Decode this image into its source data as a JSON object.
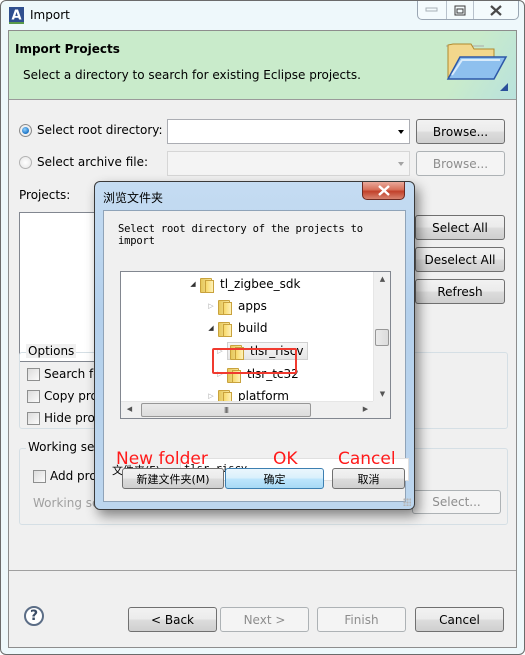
{
  "window": {
    "title": "Import",
    "app_icon": "eclipse-a-icon",
    "controls": [
      "minimize",
      "maximize",
      "close"
    ]
  },
  "banner": {
    "title": "Import Projects",
    "description": "Select a directory to search for existing Eclipse projects.",
    "icon": "open-folder-icon",
    "bg_color": "#c9ebcb"
  },
  "source": {
    "root_directory": {
      "label": "Select root directory:",
      "selected": true,
      "value": "",
      "browse_label": "Browse..."
    },
    "archive_file": {
      "label": "Select archive file:",
      "selected": false,
      "enabled": false,
      "value": "",
      "browse_label": "Browse..."
    }
  },
  "projects": {
    "label": "Projects:",
    "items": [],
    "select_all_label": "Select All",
    "deselect_all_label": "Deselect All",
    "refresh_label": "Refresh"
  },
  "options": {
    "title": "Options",
    "checkboxes": [
      {
        "label": "Search fo",
        "checked": false
      },
      {
        "label": "Copy pro",
        "checked": false
      },
      {
        "label": "Hide pro",
        "checked": false
      }
    ]
  },
  "working_sets": {
    "title": "Working se",
    "add_label": "Add pro",
    "add_checked": false,
    "working_sets_label": "Working se",
    "select_label": "Select..."
  },
  "footer": {
    "help_icon": "help-icon",
    "back_label": "< Back",
    "next_label": "Next >",
    "finish_label": "Finish",
    "cancel_label": "Cancel"
  },
  "browse_dialog": {
    "title": "浏览文件夹",
    "description": "Select root directory of the projects to import",
    "tree": [
      {
        "label": "tl_zigbee_sdk",
        "expanded": true,
        "level": 0
      },
      {
        "label": "apps",
        "expanded": false,
        "level": 1
      },
      {
        "label": "build",
        "expanded": true,
        "level": 1
      },
      {
        "label": "tlsr_riscv",
        "expanded": false,
        "level": 2,
        "selected": true
      },
      {
        "label": "tlsr_tc32",
        "expanded": false,
        "level": 2
      },
      {
        "label": "platform",
        "expanded": false,
        "level": 1
      }
    ],
    "folder_label": "文件夹(F):",
    "folder_value": "tlsr_riscv",
    "new_folder_label": "新建文件夹(M)",
    "ok_label": "确定",
    "cancel_label": "取消",
    "highlight_color": "#f03a2f"
  },
  "annotations": {
    "new_folder": "New folder",
    "ok": "OK",
    "cancel": "Cancel",
    "color": "#ff1a1a"
  }
}
